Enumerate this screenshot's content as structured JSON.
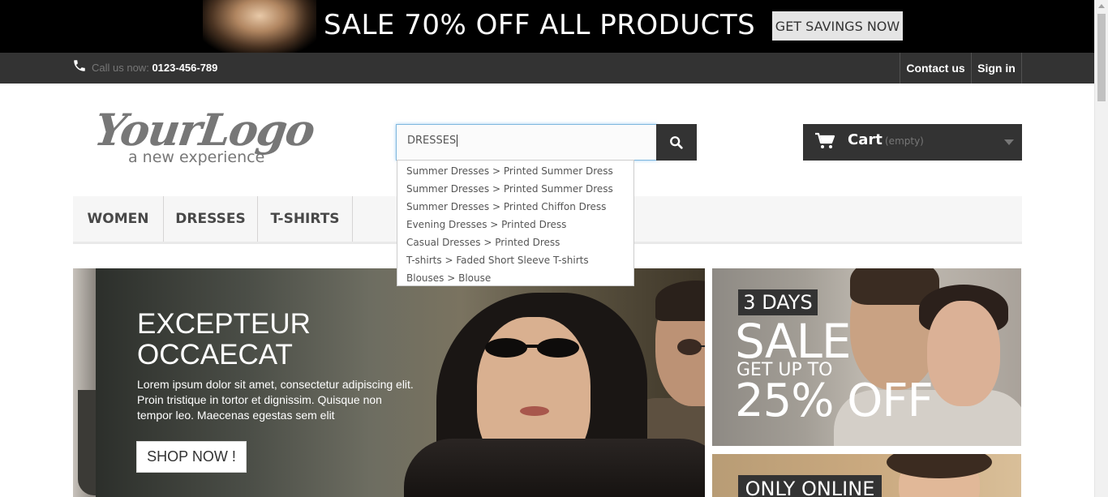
{
  "top_banner": {
    "headline": "SALE 70% OFF ALL PRODUCTS",
    "button_label": "GET SAVINGS NOW"
  },
  "nav": {
    "call_label": "Call us now:",
    "phone_number": "0123-456-789",
    "contact_label": "Contact us",
    "signin_label": "Sign in",
    "phone_icon": "phone-icon"
  },
  "logo": {
    "main": "YourLogo",
    "tagline": "a new experience"
  },
  "search": {
    "value": "DRESSES",
    "button_icon": "search-icon",
    "suggestions": [
      "Summer Dresses > Printed Summer Dress",
      "Summer Dresses > Printed Summer Dress",
      "Summer Dresses > Printed Chiffon Dress",
      "Evening Dresses > Printed Dress",
      "Casual Dresses > Printed Dress",
      "T-shirts > Faded Short Sleeve T-shirts",
      "Blouses > Blouse"
    ]
  },
  "cart": {
    "label": "Cart",
    "status": "(empty)",
    "icon": "cart-icon"
  },
  "menu": {
    "items": [
      "WOMEN",
      "DRESSES",
      "T-SHIRTS"
    ]
  },
  "slider": {
    "title_line1": "EXCEPTEUR",
    "title_line2": "OCCAECAT",
    "text": "Lorem ipsum dolor sit amet, consectetur adipiscing elit. Proin tristique in tortor et dignissim. Quisque non tempor leo. Maecenas egestas sem elit",
    "button_label": "SHOP NOW !"
  },
  "promo1": {
    "badge": "3 DAYS",
    "sale": "SALE",
    "getup": "GET UP TO",
    "off": "25% OFF"
  },
  "promo2": {
    "badge": "ONLY ONLINE"
  },
  "colors": {
    "dark": "#333333",
    "banner_bg": "#000000",
    "menu_bg": "#f6f6f6",
    "search_focus": "#66afe9"
  }
}
